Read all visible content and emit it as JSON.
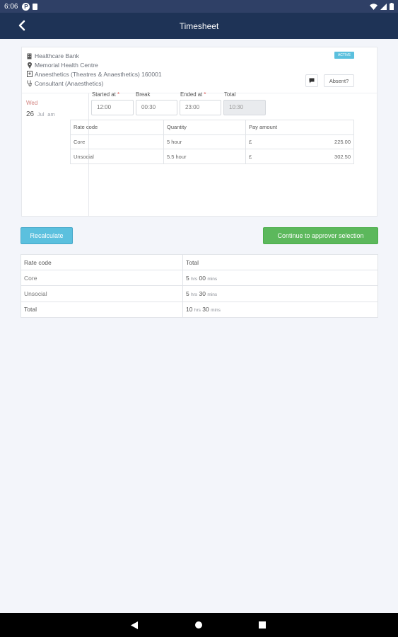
{
  "status_bar": {
    "time": "6:06",
    "icons": [
      "p-app-icon",
      "clipboard-icon",
      "wifi-icon",
      "signal-icon",
      "battery-icon"
    ]
  },
  "app_bar": {
    "title": "Timesheet",
    "back_icon": "chevron-left-icon"
  },
  "shift": {
    "organisation": "Healthcare Bank",
    "site": "Memorial Health Centre",
    "department": "Anaesthetics (Theatres & Anaesthetics) 160001",
    "role": "Consultant (Anaesthetics)",
    "day": "Wed",
    "date_num": "26",
    "date_rest": "Jul",
    "date_suffix": "am",
    "status_badge": "ACTIVE",
    "absent_label": "Absent?"
  },
  "times": {
    "started_label": "Started at",
    "break_label": "Break",
    "ended_label": "Ended at",
    "total_label": "Total",
    "required_mark": "*",
    "started_value": "12:00",
    "break_value": "00:30",
    "ended_value": "23:00",
    "total_value": "10:30"
  },
  "rate_table": {
    "headers": [
      "Rate code",
      "Quantity",
      "Pay amount"
    ],
    "rows": [
      {
        "code": "Core",
        "quantity": "5 hour",
        "currency": "£",
        "amount": "225.00"
      },
      {
        "code": "Unsocial",
        "quantity": "5.5 hour",
        "currency": "£",
        "amount": "302.50"
      }
    ]
  },
  "actions": {
    "recalculate": "Recalculate",
    "continue": "Continue to approver selection"
  },
  "summary": {
    "headers": [
      "Rate code",
      "Total"
    ],
    "rows": [
      {
        "code": "Core",
        "hrs": "5",
        "hrs_unit": "hrs",
        "mins": "00",
        "mins_unit": "mins"
      },
      {
        "code": "Unsocial",
        "hrs": "5",
        "hrs_unit": "hrs",
        "mins": "30",
        "mins_unit": "mins"
      },
      {
        "code": "Total",
        "hrs": "10",
        "hrs_unit": "hrs",
        "mins": "30",
        "mins_unit": "mins"
      }
    ]
  },
  "colors": {
    "app_bar": "#1e3356",
    "recalc": "#5bc0de",
    "continue": "#5cb85c",
    "day": "#d1807d"
  }
}
